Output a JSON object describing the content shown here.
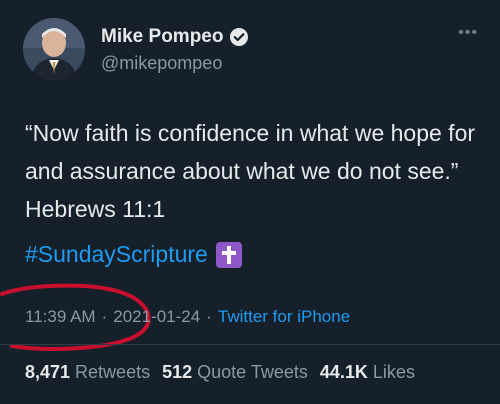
{
  "author": {
    "name": "Mike Pompeo",
    "handle": "@mikepompeo"
  },
  "tweet": {
    "text": "“Now faith is confidence in what we hope for and assurance about what we do not see.” Hebrews 11:1",
    "hashtag": "#SundayScripture",
    "emoji": "cross-emoji"
  },
  "meta": {
    "time": "11:39 AM",
    "separator1": "·",
    "date": "2021-01-24",
    "separator2": "·",
    "source": "Twitter for iPhone"
  },
  "stats": {
    "retweets_count": "8,471",
    "retweets_label": "Retweets",
    "quotes_count": "512",
    "quotes_label": "Quote Tweets",
    "likes_count": "44.1K",
    "likes_label": "Likes"
  },
  "icons": {
    "verified": "verified-badge-icon",
    "more": "more-options-icon"
  },
  "colors": {
    "background": "#16202a",
    "accent": "#1d9bf0",
    "annotation": "#c8102e"
  }
}
